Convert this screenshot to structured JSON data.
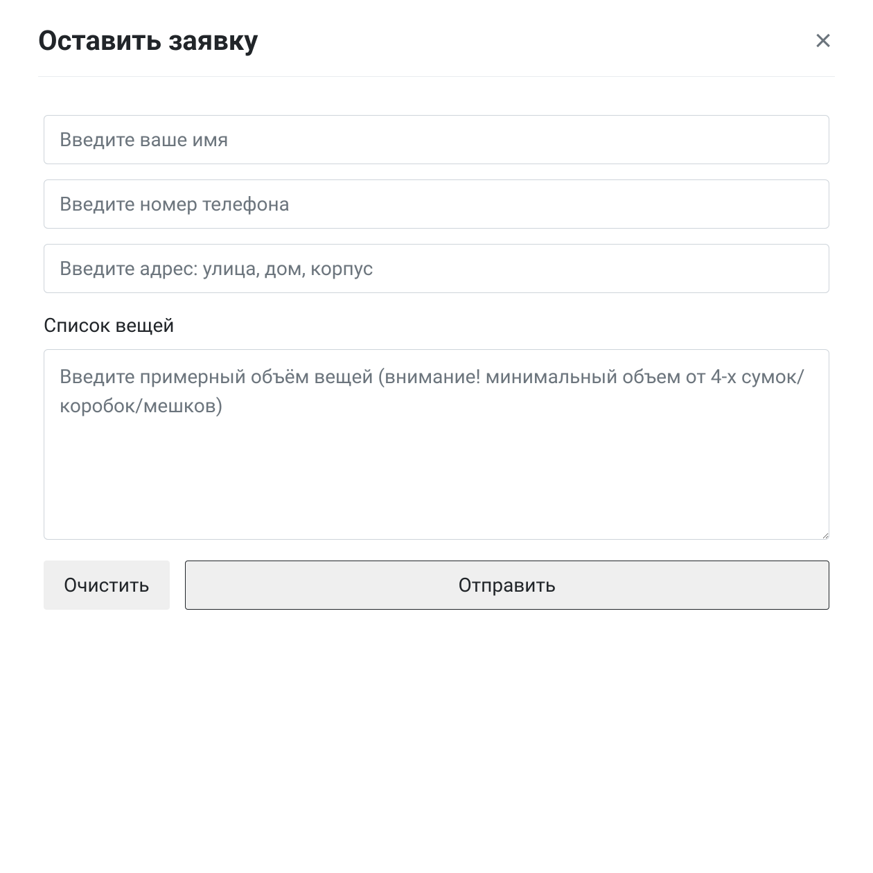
{
  "modal": {
    "title": "Оставить заявку",
    "close_label": "×"
  },
  "form": {
    "name": {
      "placeholder": "Введите ваше имя",
      "value": ""
    },
    "phone": {
      "placeholder": "Введите номер телефона",
      "value": ""
    },
    "address": {
      "placeholder": "Введите адрес: улица, дом, корпус",
      "value": ""
    },
    "items_label": "Список вещей",
    "items": {
      "placeholder": "Введите примерный объём вещей (внимание! минимальный объем от 4-х сумок/коробок/мешков)",
      "value": ""
    }
  },
  "buttons": {
    "clear_label": "Очистить",
    "submit_label": "Отправить"
  }
}
